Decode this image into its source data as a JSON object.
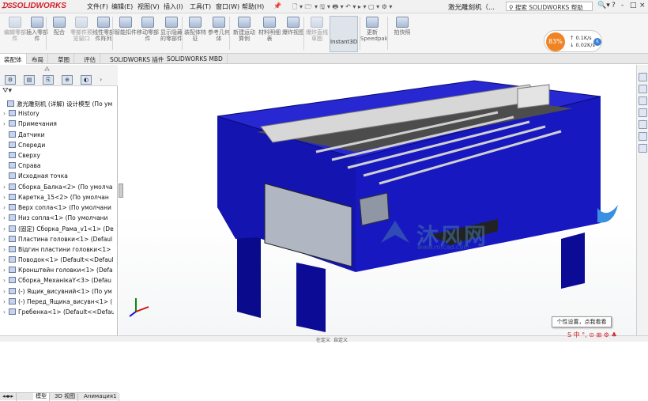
{
  "app": {
    "logo_text": "SOLIDWORKS",
    "doc_title": "激光雕刻机（..."
  },
  "menu": [
    "文件(F)",
    "编辑(E)",
    "视图(V)",
    "插入(I)",
    "工具(T)",
    "窗口(W)",
    "帮助(H)"
  ],
  "help_search": {
    "placeholder": "搜索 SOLIDWORKS 帮助"
  },
  "window_controls": [
    "?",
    "-",
    "□",
    "×"
  ],
  "ribbon": [
    {
      "label": "编辑零部件",
      "disabled": true
    },
    {
      "label": "插入零部件",
      "disabled": false
    },
    {
      "label": "配合",
      "disabled": false
    },
    {
      "label": "零部件预览窗口",
      "disabled": true
    },
    {
      "label": "线性零部件阵列",
      "disabled": false
    },
    {
      "label": "智能扣件",
      "disabled": false
    },
    {
      "label": "移动零部件",
      "disabled": false
    },
    {
      "label": "显示隐藏的零部件",
      "disabled": false
    },
    {
      "label": "装配体特征",
      "disabled": false
    },
    {
      "label": "参考几何体",
      "disabled": false
    },
    {
      "label": "新建运动算例",
      "disabled": false
    },
    {
      "label": "材料明细表",
      "disabled": false
    },
    {
      "label": "爆炸视图",
      "disabled": false
    },
    {
      "label": "爆炸直线草图",
      "disabled": true
    },
    {
      "label": "Instant3D",
      "disabled": false
    },
    {
      "label": "更新Speedpak",
      "disabled": false
    },
    {
      "label": "拍快照",
      "disabled": false
    }
  ],
  "tabs": [
    "装配体",
    "布局",
    "草图",
    "评估",
    "SOLIDWORKS 插件",
    "SOLIDWORKS MBD"
  ],
  "active_tab": 0,
  "perf": {
    "percent": "83%",
    "up": "0.1K/s",
    "down": "0.02K/s",
    "unit": "K"
  },
  "tree": [
    {
      "label": "激光雕刻机 (详解) 设计模型 (По умо",
      "arrow": ""
    },
    {
      "label": "History",
      "arrow": "›"
    },
    {
      "label": "Примечания",
      "arrow": "›"
    },
    {
      "label": "Датчики",
      "arrow": ""
    },
    {
      "label": "Спереди",
      "arrow": ""
    },
    {
      "label": "Сверху",
      "arrow": ""
    },
    {
      "label": "Справа",
      "arrow": ""
    },
    {
      "label": "Исходная точка",
      "arrow": ""
    },
    {
      "label": "Сборка_Балка<2> (По умолча",
      "arrow": "›"
    },
    {
      "label": "Каретка_15<2> (По умолчан",
      "arrow": "›"
    },
    {
      "label": "Верх сопла<1> (По умолчани",
      "arrow": "›"
    },
    {
      "label": "Низ сопла<1> (По умолчани",
      "arrow": "›"
    },
    {
      "label": "(固定) Сборка_Рама_v1<1> (De",
      "arrow": "›"
    },
    {
      "label": "Пластина головки<1> (Defaul",
      "arrow": "›"
    },
    {
      "label": "Відгин пластини головки<1>",
      "arrow": "›"
    },
    {
      "label": "Поводок<1> (Default<<Defaul",
      "arrow": "›"
    },
    {
      "label": "Кронштейн головки<1> (Defa",
      "arrow": "›"
    },
    {
      "label": "Сборка_МеханікаY<3> (Defau",
      "arrow": "›"
    },
    {
      "label": "(-) Ящик_висувний<1> (По ум",
      "arrow": "›"
    },
    {
      "label": "(-) Перед_Ящика_висувн<1> (",
      "arrow": "›"
    },
    {
      "label": "Гребенка<1> (Default<<Defau",
      "arrow": "›"
    }
  ],
  "left_tabs": [
    "模型",
    "3D 视图",
    "Анимация1"
  ],
  "watermark": {
    "text": "沐风网",
    "url": "www.mfcad.com"
  },
  "tooltip": "个性设置，点我看看",
  "status": [
    "在定义",
    "自定义"
  ]
}
